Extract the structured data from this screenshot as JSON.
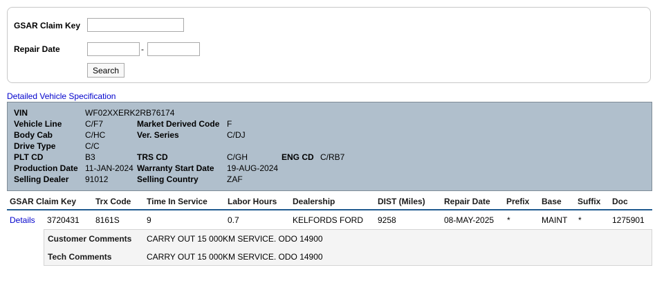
{
  "search": {
    "claim_key_label": "GSAR Claim Key",
    "claim_key_value": "",
    "repair_date_label": "Repair Date",
    "repair_date_from": "",
    "repair_date_separator": "-",
    "repair_date_to": "",
    "search_button": "Search"
  },
  "spec": {
    "link": "Detailed Vehicle Specification",
    "vin_label": "VIN",
    "vin": "WF02XXERK2RB76174",
    "vehicle_line_label": "Vehicle Line",
    "vehicle_line": "C/F7",
    "market_derived_code_label": "Market Derived Code",
    "market_derived_code": "F",
    "body_cab_label": "Body Cab",
    "body_cab": "C/HC",
    "ver_series_label": "Ver. Series",
    "ver_series": "C/DJ",
    "drive_type_label": "Drive Type",
    "drive_type": "C/C",
    "plt_cd_label": "PLT CD",
    "plt_cd": "B3",
    "trs_cd_label": "TRS CD",
    "trs_cd": "C/GH",
    "eng_cd_label": "ENG CD",
    "eng_cd": "C/RB7",
    "production_date_label": "Production Date",
    "production_date": "11-JAN-2024",
    "warranty_start_date_label": "Warranty Start Date",
    "warranty_start_date": "19-AUG-2024",
    "selling_dealer_label": "Selling Dealer",
    "selling_dealer": "91012",
    "selling_country_label": "Selling Country",
    "selling_country": "ZAF"
  },
  "table": {
    "headers": [
      "GSAR Claim Key",
      "Trx Code",
      "Time In Service",
      "Labor Hours",
      "Dealership",
      "DIST (Miles)",
      "Repair Date",
      "Prefix",
      "Base",
      "Suffix",
      "Doc"
    ],
    "rows": [
      {
        "details": "Details",
        "claim_key": "3720431",
        "trx_code": "8161S",
        "time_in_service": "9",
        "labor_hours": "0.7",
        "dealership": "KELFORDS FORD",
        "dist_miles": "9258",
        "repair_date": "08-MAY-2025",
        "prefix": "*",
        "base": "MAINT",
        "suffix": "*",
        "doc": "1275901",
        "customer_comments_label": "Customer Comments",
        "customer_comments": "CARRY OUT 15 000KM SERVICE. ODO 14900",
        "tech_comments_label": "Tech Comments",
        "tech_comments": "CARRY OUT 15 000KM SERVICE. ODO 14900"
      }
    ]
  },
  "colors": {
    "spec_background": "#b0bfcc",
    "link": "#0000cc",
    "header_rule": "#1f5a8f",
    "comments_background": "#f4f4f4"
  }
}
